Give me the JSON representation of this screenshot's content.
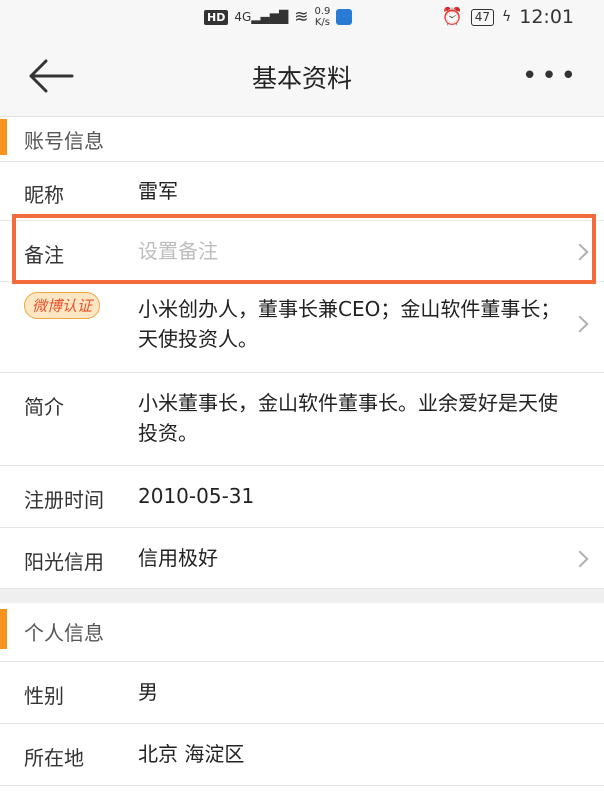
{
  "status": {
    "hd": "HD",
    "signal": "4G",
    "net_speed_top": "0.9",
    "net_speed_bottom": "K/s",
    "battery": "47",
    "time": "12:01"
  },
  "header": {
    "title": "基本资料",
    "more_label": "•••"
  },
  "account_section": {
    "title": "账号信息",
    "nickname": {
      "label": "昵称",
      "value": "雷军"
    },
    "remark": {
      "label": "备注",
      "placeholder": "设置备注"
    },
    "verification": {
      "badge": "微博认证",
      "value": "小米创办人，董事长兼CEO；金山软件董事长；天使投资人。"
    },
    "intro": {
      "label": "简介",
      "value": "小米董事长，金山软件董事长。业余爱好是天使投资。"
    },
    "reg_time": {
      "label": "注册时间",
      "value": "2010-05-31"
    },
    "credit": {
      "label": "阳光信用",
      "value": "信用极好"
    }
  },
  "personal_section": {
    "title": "个人信息",
    "gender": {
      "label": "性别",
      "value": "男"
    },
    "location": {
      "label": "所在地",
      "value": "北京 海淀区"
    }
  },
  "colors": {
    "accent": "#f7931e",
    "highlight": "#f26b3a"
  }
}
